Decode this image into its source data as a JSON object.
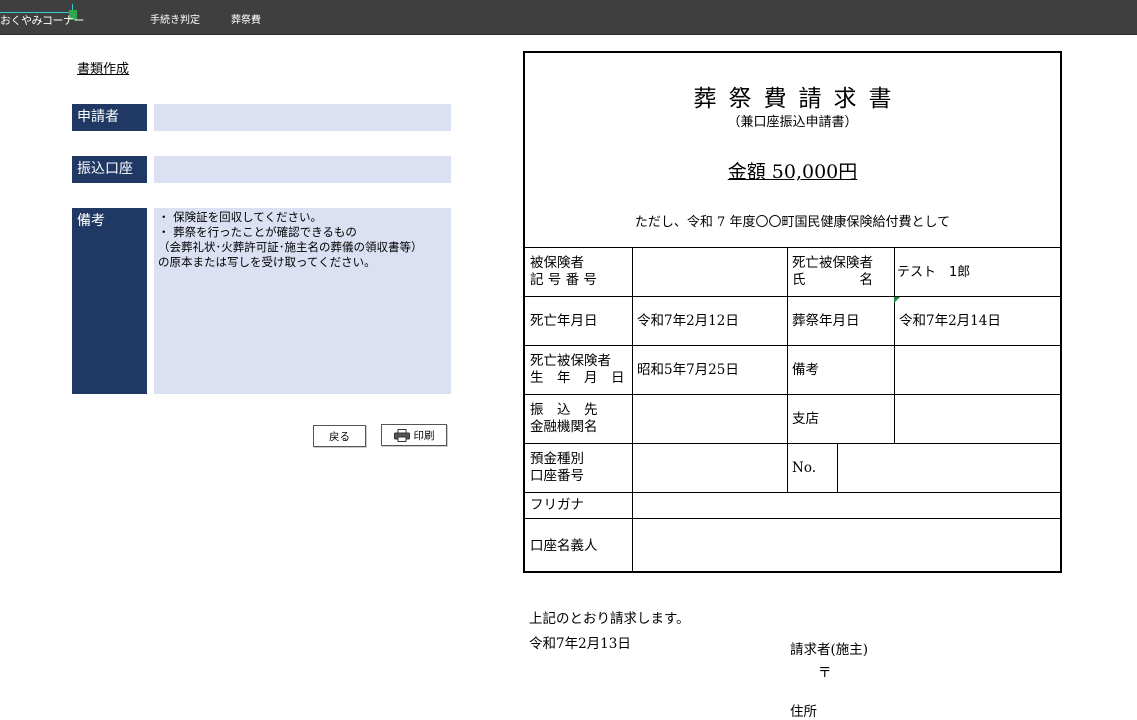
{
  "header": {
    "brand": "おくやみコーナー",
    "nav": [
      "手続き判定",
      "葬祭費"
    ]
  },
  "form": {
    "title": "書類作成",
    "applicant_label": "申請者",
    "account_label": "振込口座",
    "note_label": "備考",
    "note_text": "・ 保険証を回収してください。\n・ 葬祭を行ったことが確認できるもの\n（会葬礼状･火葬許可証･施主名の葬儀の領収書等）\nの原本または写しを受け取ってください。",
    "back_button": "戻る",
    "print_button": "印刷"
  },
  "document": {
    "title": "葬祭費請求書",
    "subtitle": "（兼口座振込申請書）",
    "amount": "金額 50,000円",
    "description": "ただし、令和 7 年度〇〇町国民健康保険給付費として",
    "table": {
      "insured_number_label": "被保険者\n記 号 番 号",
      "insured_number_value": "",
      "deceased_name_label": "死亡被保険者\n氏　　　　名",
      "deceased_name_value": "テスト　1郎",
      "death_date_label": "死亡年月日",
      "death_date_value": "令和7年2月12日",
      "funeral_date_label": "葬祭年月日",
      "funeral_date_value": "令和7年2月14日",
      "birth_date_label": "死亡被保険者\n生　年　月　日",
      "birth_date_value": "昭和5年7月25日",
      "remarks_label": "備考",
      "remarks_value": "",
      "bank_label": "振　込　先\n金融機関名",
      "bank_value": "",
      "branch_label": "支店",
      "branch_value": "",
      "deposit_label": "預金種別\n口座番号",
      "deposit_value": "",
      "no_label": "No.",
      "no_value": "",
      "furigana_label": "フリガナ",
      "furigana_value": "",
      "holder_label": "口座名義人",
      "holder_value": ""
    },
    "statement": "上記のとおり請求します。",
    "date": "令和7年2月13日",
    "claimant_label": "請求者(施主)",
    "postal_mark": "〒",
    "address_label": "住所"
  }
}
